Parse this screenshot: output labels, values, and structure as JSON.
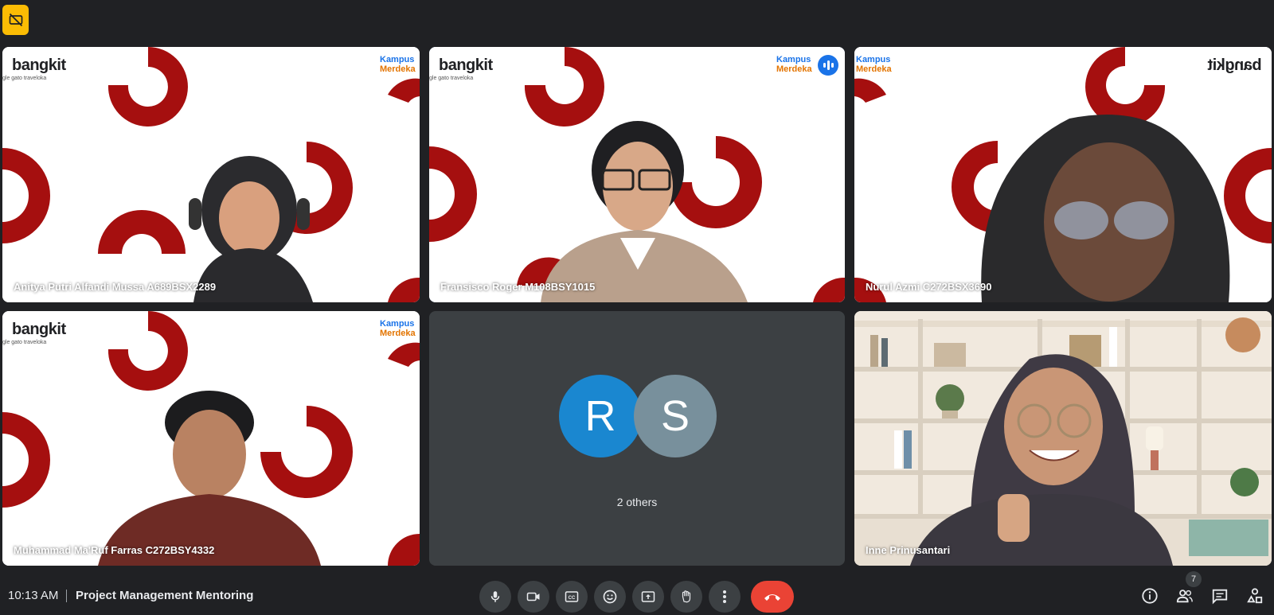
{
  "colors": {
    "background": "#202124",
    "tile_dark": "#3c4043",
    "active_outline": "#8ab4f8",
    "hangup": "#ea4335",
    "brand_red": "#a50f0f",
    "avatar_r": "#1a87d0",
    "avatar_s": "#78909c",
    "warning": "#fbbc04"
  },
  "top_badge": {
    "icon": "no-video-warning-icon"
  },
  "tiles": [
    {
      "name": "Anitya Putri Alfandi Mussa A689BSX2289",
      "brand": "bangkit",
      "brand_sub": "gle  gato  traveloka",
      "km_1": "Kampus",
      "km_2": "Merdeka"
    },
    {
      "name": "Fransisco Roger M108BSY1015",
      "brand": "bangkit",
      "brand_sub": "gle  gato  traveloka",
      "km_1": "Kampus",
      "km_2": "Merdeka",
      "speaking": true
    },
    {
      "name": "Nurul Azmi C272BSX3690",
      "brand": "bangkit",
      "km_1": "Kampus",
      "km_2": "Merdeka"
    },
    {
      "name": "Muhammad Ma'Ruf Farras C272BSY4332",
      "brand": "bangkit",
      "brand_sub": "gle  gato  traveloka",
      "km_1": "Kampus",
      "km_2": "Merdeka"
    },
    {
      "name": "Inne Prinusantari"
    }
  ],
  "others": {
    "avatar_1": "R",
    "avatar_2": "S",
    "label": "2 others"
  },
  "bottom_bar": {
    "time": "10:13 AM",
    "meeting_title": "Project Management Mentoring",
    "participant_count": "7",
    "controls": [
      "mic-icon",
      "camera-icon",
      "captions-icon",
      "emoji-icon",
      "present-icon",
      "raise-hand-icon",
      "more-options-icon",
      "hang-up-icon"
    ],
    "right_controls": [
      "info-icon",
      "people-icon",
      "chat-icon",
      "activities-icon"
    ]
  }
}
